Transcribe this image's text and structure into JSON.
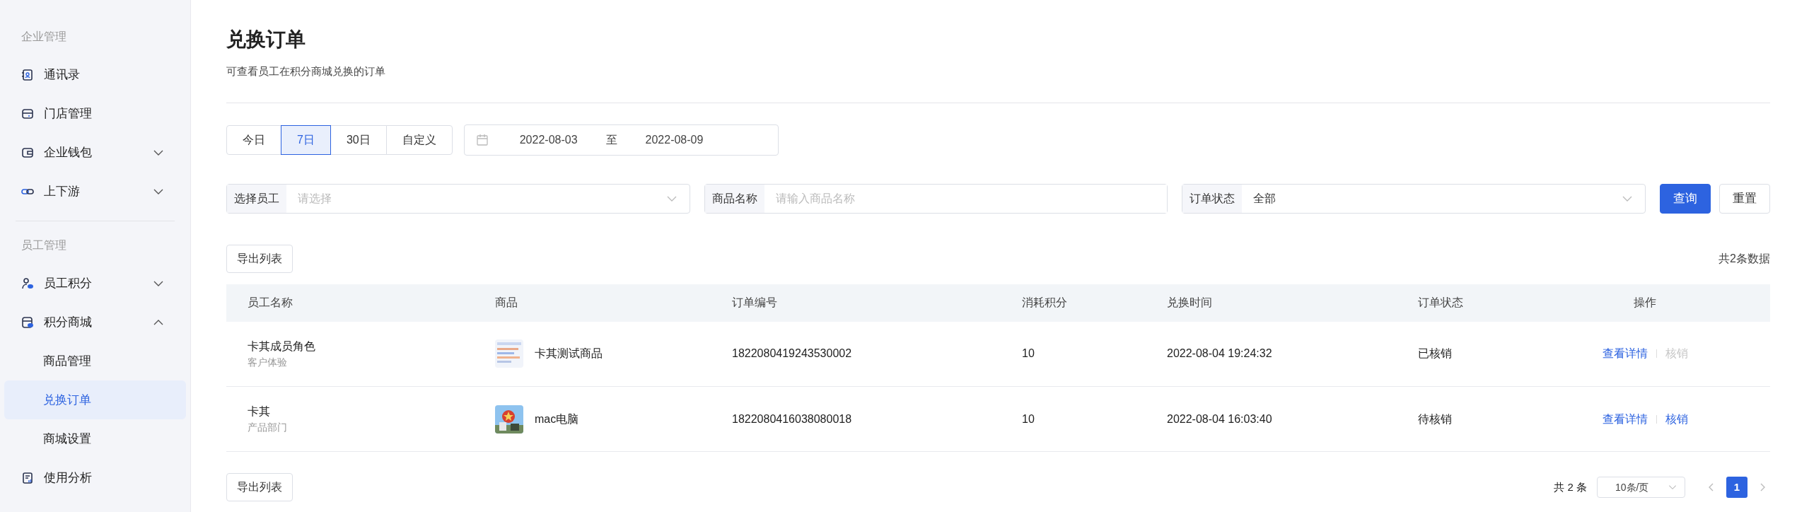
{
  "sidebar": {
    "sections": [
      {
        "title": "企业管理",
        "items": [
          {
            "label": "通讯录",
            "selected": false
          },
          {
            "label": "门店管理",
            "selected": false
          },
          {
            "label": "企业钱包",
            "selected": false,
            "expanded": false
          },
          {
            "label": "上下游",
            "selected": false,
            "expanded": false
          }
        ]
      },
      {
        "title": "员工管理",
        "items": [
          {
            "label": "员工积分",
            "selected": false,
            "expanded": false
          },
          {
            "label": "积分商城",
            "selected": false,
            "expanded": true,
            "children": [
              {
                "label": "商品管理",
                "selected": false
              },
              {
                "label": "兑换订单",
                "selected": true
              },
              {
                "label": "商城设置",
                "selected": false
              }
            ]
          },
          {
            "label": "使用分析",
            "selected": false
          }
        ]
      }
    ]
  },
  "page": {
    "title": "兑换订单",
    "subtitle": "可查看员工在积分商城兑换的订单"
  },
  "date_presets": [
    {
      "label": "今日",
      "selected": false
    },
    {
      "label": "7日",
      "selected": true
    },
    {
      "label": "30日",
      "selected": false
    },
    {
      "label": "自定义",
      "selected": false
    }
  ],
  "date_range": {
    "start": "2022-08-03",
    "separator": "至",
    "end": "2022-08-09"
  },
  "filters": [
    {
      "kind": "select",
      "label": "选择员工",
      "placeholder": "请选择"
    },
    {
      "kind": "input",
      "label": "商品名称",
      "placeholder": "请输入商品名称"
    },
    {
      "kind": "select",
      "label": "订单状态",
      "value": "全部"
    }
  ],
  "filter_buttons": [
    {
      "label": "查询",
      "kind": "primary"
    },
    {
      "label": "重置",
      "kind": "default"
    }
  ],
  "export_top": "导出列表",
  "total_text": "共2条数据",
  "table": {
    "columns": [
      "员工名称",
      "商品",
      "订单编号",
      "消耗积分",
      "兑换时间",
      "订单状态",
      "操作"
    ],
    "rows": [
      {
        "employee": "卡其成员角色",
        "department": "客户体验",
        "product": "卡其测试商品",
        "order_no": "1822080419243530002",
        "points": "10",
        "time": "2022-08-04 19:24:32",
        "status": "已核销",
        "actions": [
          {
            "label": "查看详情",
            "disabled": false
          },
          {
            "label": "核销",
            "disabled": true
          }
        ]
      },
      {
        "employee": "卡其",
        "department": "产品部门",
        "product": "mac电脑",
        "order_no": "1822080416038080018",
        "points": "10",
        "time": "2022-08-04 16:03:40",
        "status": "待核销",
        "actions": [
          {
            "label": "查看详情",
            "disabled": false
          },
          {
            "label": "核销",
            "disabled": false
          }
        ]
      }
    ]
  },
  "export_bottom": "导出列表",
  "pagination": {
    "total": "共 2 条",
    "page_size": "10条/页",
    "pages": [
      {
        "label": "1",
        "selected": true
      }
    ]
  }
}
